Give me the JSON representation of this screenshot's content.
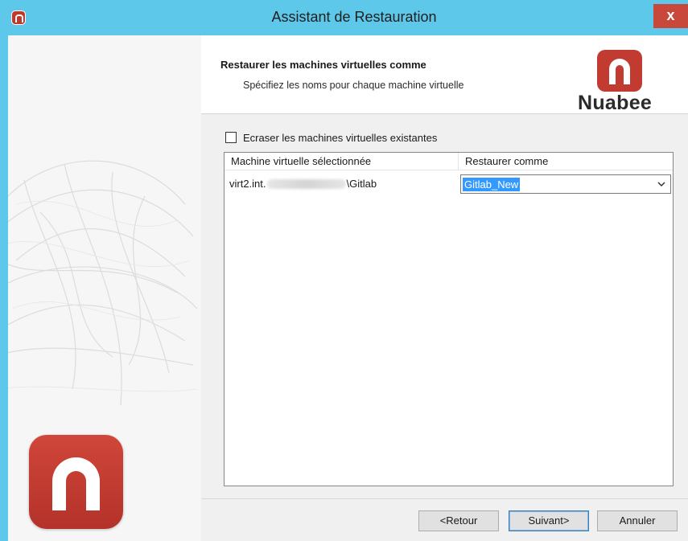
{
  "window": {
    "title": "Assistant de Restauration",
    "close_label": "x",
    "icon": "nuabee-app-icon"
  },
  "header": {
    "title": "Restaurer les machines virtuelles comme",
    "subtitle": "Spécifiez les noms pour chaque machine virtuelle",
    "brand": "Nuabee",
    "brand_icon": "nuabee-logo-icon"
  },
  "options": {
    "overwrite_label": "Ecraser les machines virtuelles existantes",
    "overwrite_checked": false
  },
  "table": {
    "columns": [
      "Machine virtuelle sélectionnée",
      "Restaurer comme"
    ],
    "rows": [
      {
        "vm_prefix": "virt2.int.",
        "vm_suffix": "\\Gitlab",
        "restore_as": "Gitlab_New"
      }
    ]
  },
  "buttons": {
    "back": "<Retour",
    "next": "Suivant>",
    "cancel": "Annuler"
  },
  "colors": {
    "titlebar": "#5ec8ea",
    "brand_red": "#c13b30",
    "selection": "#3399ff"
  }
}
